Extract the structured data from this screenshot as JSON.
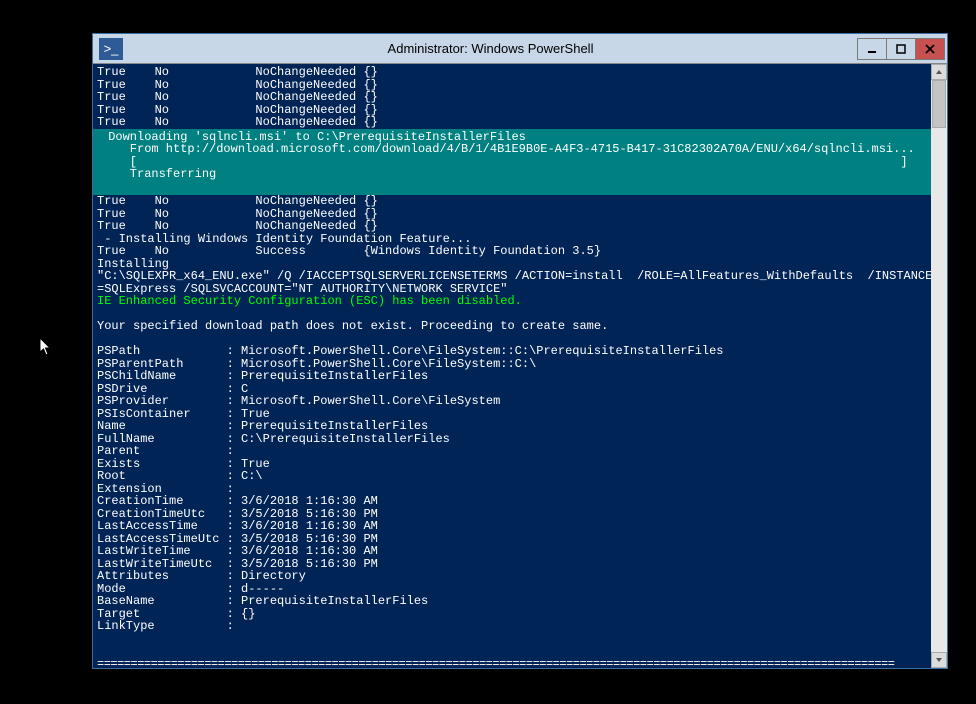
{
  "window": {
    "title": "Administrator: Windows PowerShell",
    "icon_glyph": ">_"
  },
  "before_lines": [
    "True    No            NoChangeNeeded {}",
    "True    No            NoChangeNeeded {}",
    "True    No            NoChangeNeeded {}",
    "True    No            NoChangeNeeded {}",
    "True    No            NoChangeNeeded {}"
  ],
  "progress": {
    "line1": " Downloading 'sqlncli.msi' to C:\\PrerequisiteInstallerFiles",
    "line2": "    From http://download.microsoft.com/download/4/B/1/4B1E9B0E-A4F3-4715-B417-31C82302A70A/ENU/x64/sqlncli.msi...",
    "bar": "    [                                                                                                          ]",
    "line3": "    Transferring",
    "blank": " "
  },
  "after_lines": [
    "True    No            NoChangeNeeded {}",
    "True    No            NoChangeNeeded {}",
    "True    No            NoChangeNeeded {}",
    " - Installing Windows Identity Foundation Feature...",
    "True    No            Success        {Windows Identity Foundation 3.5}",
    "Installing",
    "\"C:\\SQLEXPR_x64_ENU.exe\" /Q /IACCEPTSQLSERVERLICENSETERMS /ACTION=install  /ROLE=AllFeatures_WithDefaults  /INSTANCENAME",
    "=SQLExpress /SQLSVCACCOUNT=\"NT AUTHORITY\\NETWORK SERVICE\""
  ],
  "esc_line": "IE Enhanced Security Configuration (ESC) has been disabled.",
  "path_line": "Your specified download path does not exist. Proceeding to create same.",
  "properties": [
    "PSPath            : Microsoft.PowerShell.Core\\FileSystem::C:\\PrerequisiteInstallerFiles",
    "PSParentPath      : Microsoft.PowerShell.Core\\FileSystem::C:\\",
    "PSChildName       : PrerequisiteInstallerFiles",
    "PSDrive           : C",
    "PSProvider        : Microsoft.PowerShell.Core\\FileSystem",
    "PSIsContainer     : True",
    "Name              : PrerequisiteInstallerFiles",
    "FullName          : C:\\PrerequisiteInstallerFiles",
    "Parent            :",
    "Exists            : True",
    "Root              : C:\\",
    "Extension         :",
    "CreationTime      : 3/6/2018 1:16:30 AM",
    "CreationTimeUtc   : 3/5/2018 5:16:30 PM",
    "LastAccessTime    : 3/6/2018 1:16:30 AM",
    "LastAccessTimeUtc : 3/5/2018 5:16:30 PM",
    "LastWriteTime     : 3/6/2018 1:16:30 AM",
    "LastWriteTimeUtc  : 3/5/2018 5:16:30 PM",
    "Attributes        : Directory",
    "Mode              : d-----",
    "BaseName          : PrerequisiteInstallerFiles",
    "Target            : {}",
    "LinkType          :"
  ],
  "separator": "======================================================================================================================="
}
